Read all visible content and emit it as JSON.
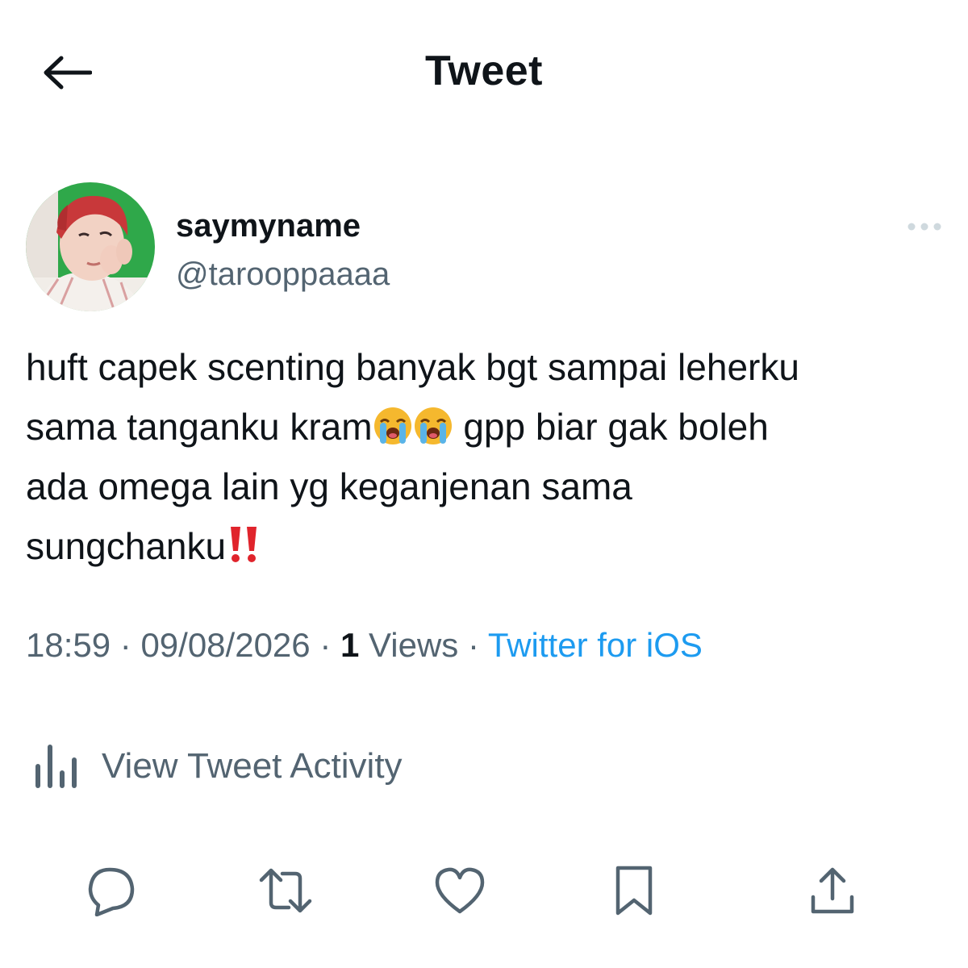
{
  "header": {
    "title": "Tweet",
    "back_icon": "arrow-left-icon"
  },
  "author": {
    "display_name": "saymyname",
    "handle": "@tarooppaaaa",
    "avatar": "avatar-photo",
    "more_icon": "more-horizontal-icon"
  },
  "tweet": {
    "line1": "huft capek scenting banyak bgt sampai leherku",
    "line2_part1": "sama tanganku kram",
    "line2_part2": " gpp biar gak boleh",
    "line3": "ada omega lain yg keganjenan sama",
    "line4": "sungchanku",
    "emoji_1": "loudly-crying-face",
    "emoji_2": "loudly-crying-face",
    "emoji_3": "double-exclamation-mark"
  },
  "meta": {
    "time": "18:59",
    "separator": " · ",
    "date": "09/08/2026",
    "views_count": "1",
    "views_label": " Views",
    "source": "Twitter for iOS"
  },
  "activity": {
    "label": "View Tweet Activity",
    "icon": "analytics-icon"
  },
  "actions": {
    "reply_icon": "reply-icon",
    "retweet_icon": "retweet-icon",
    "like_icon": "heart-icon",
    "bookmark_icon": "bookmark-icon",
    "share_icon": "share-icon"
  },
  "colors": {
    "text_primary": "#0f1419",
    "text_secondary": "#536471",
    "link": "#1d9bf0",
    "icon_muted": "#cfd9de"
  }
}
